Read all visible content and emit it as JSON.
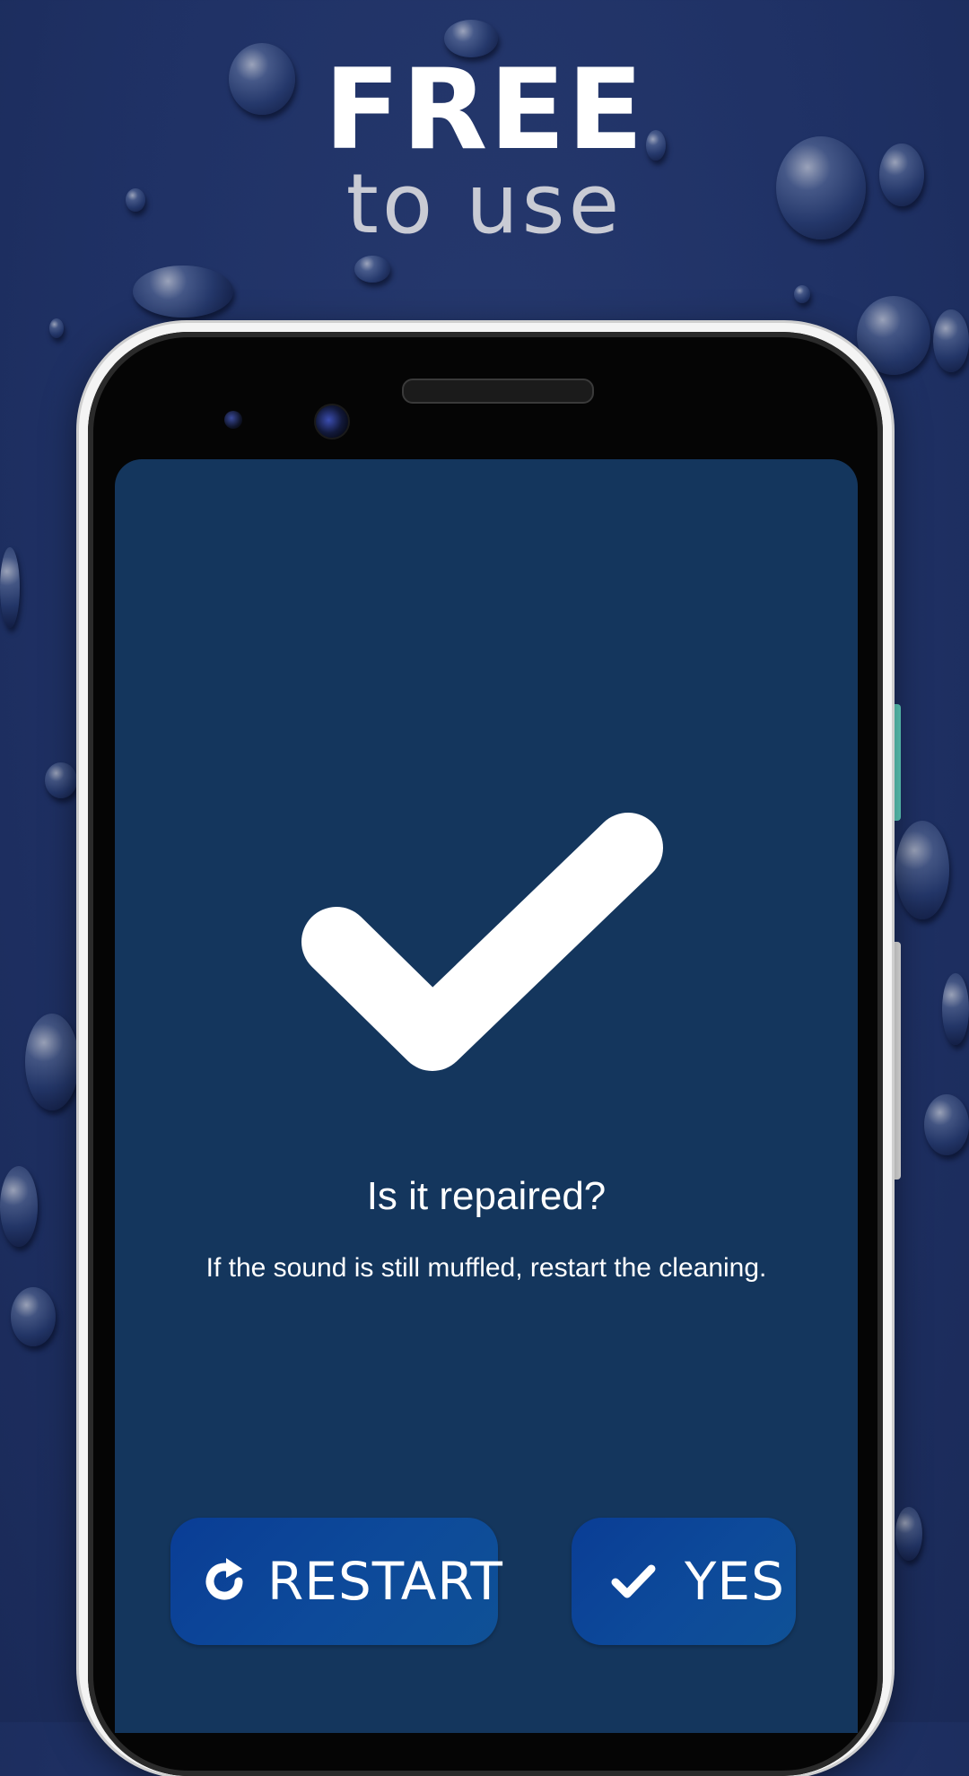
{
  "headline": {
    "main": "FREE",
    "sub": "to use"
  },
  "dialog": {
    "question": "Is it repaired?",
    "hint": "If the sound is still muffled, restart the cleaning.",
    "status_icon": "checkmark-icon"
  },
  "buttons": {
    "restart_label": "RESTART",
    "restart_icon": "refresh-icon",
    "yes_label": "YES",
    "yes_icon": "check-icon"
  },
  "colors": {
    "background": "#1f3165",
    "screen": "#14365d",
    "button": "#0c4597",
    "text": "#ffffff",
    "subheadline": "#c9cbd4"
  }
}
